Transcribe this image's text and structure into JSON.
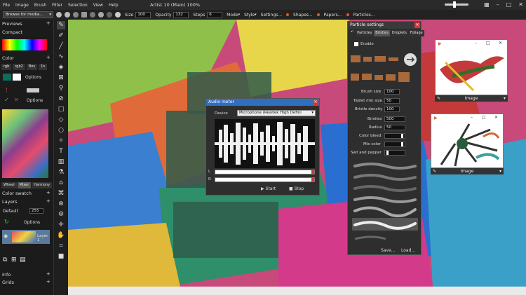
{
  "menubar": {
    "items": [
      "File",
      "Image",
      "Brush",
      "Filter",
      "Selection",
      "View",
      "Help"
    ],
    "title": "Artist 10 (Main)  100%"
  },
  "toolbar": {
    "browse": "Browse for media...",
    "size_label": "Size",
    "size_value": "100",
    "opacity_label": "Opacity",
    "opacity_value": "132",
    "steps_label": "Steps",
    "steps_value": "6",
    "mode_label": "Mode",
    "style_label": "Style",
    "settings": "Settings...",
    "shapes": "Shapes...",
    "papers": "Papers...",
    "particles": "Particles..."
  },
  "left_panel": {
    "previews": "Previews",
    "compact": "Compact",
    "color": "Color",
    "color_tabs": [
      "rgb",
      "rgb2",
      "Box",
      "1n"
    ],
    "options": "Options",
    "wheel_tabs": [
      "Wheel",
      "Mixer",
      "Harmony"
    ],
    "color_swatch": "Color swatch",
    "layers": "Layers",
    "blend": "Default",
    "opacity": "255",
    "layer_options": "Options",
    "layer_name": "Layer 1",
    "info": "Info",
    "grids": "Grids"
  },
  "audio_meter": {
    "title": "Audio meter",
    "device_label": "Device",
    "device_value": "Microphone (Realtek High Defini",
    "left": "L",
    "right": "R",
    "start": "Start",
    "stop": "Stop"
  },
  "particle_settings": {
    "title": "Particle settings",
    "tabs": [
      "Particles",
      "Bristles",
      "Droplets",
      "Foliage"
    ],
    "enable": "Enable",
    "params": [
      {
        "label": "Brush size",
        "value": "100"
      },
      {
        "label": "Tablet min size",
        "value": "50"
      },
      {
        "label": "Bristle density",
        "value": "100"
      },
      {
        "label": "Bristles",
        "value": "500"
      },
      {
        "label": "Radius",
        "value": "50"
      },
      {
        "label": "Color bleed",
        "value": ""
      },
      {
        "label": "Mix color",
        "value": ""
      },
      {
        "label": "Salt and pepper",
        "value": ""
      }
    ],
    "save": "Save...",
    "load": "Load..."
  },
  "image_windows": [
    {
      "label": "Image"
    },
    {
      "label": "Image"
    }
  ],
  "colors": {
    "title_blue": "#2f6fbf",
    "accent_orange": "#e05a2e"
  }
}
